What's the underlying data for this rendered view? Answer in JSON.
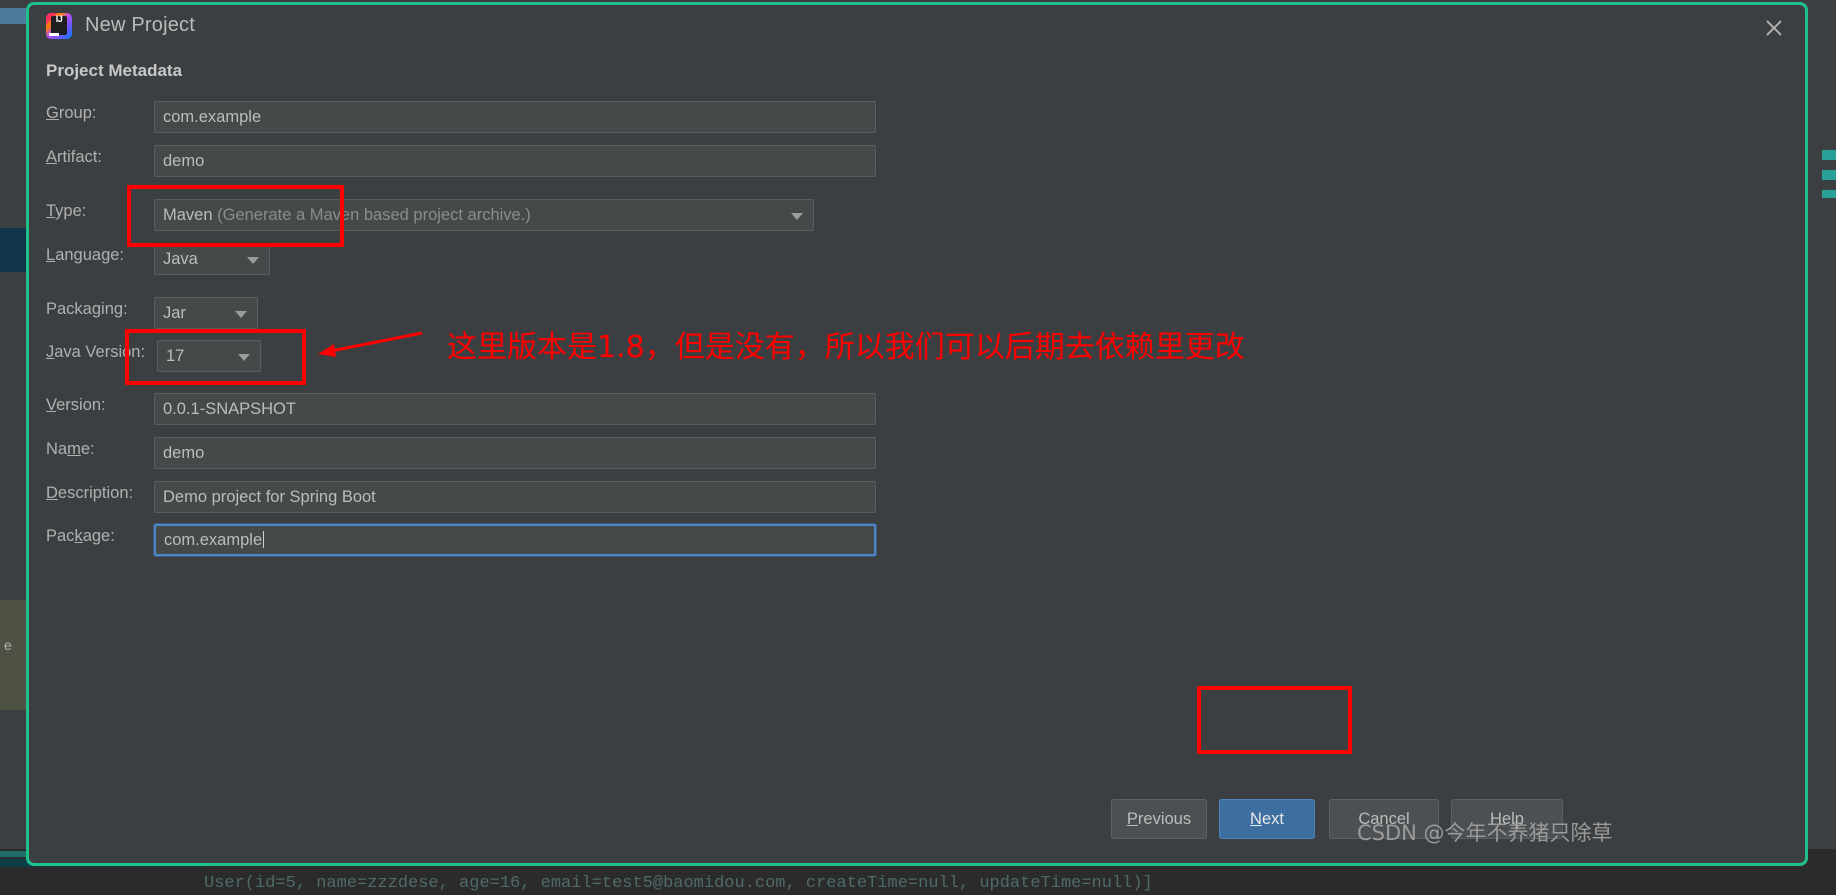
{
  "dialog": {
    "title": "New Project",
    "logo_text": "IJ",
    "close_icon": "close-icon",
    "section_title": "Project Metadata",
    "accent_border": "#21c08b"
  },
  "form": {
    "group": {
      "label_pre": "",
      "label_mnemonic": "G",
      "label_post": "roup:",
      "value": "com.example"
    },
    "artifact": {
      "label_pre": "",
      "label_mnemonic": "A",
      "label_post": "rtifact:",
      "value": "demo"
    },
    "type": {
      "label_pre": "",
      "label_mnemonic": "T",
      "label_post": "ype:",
      "value": "Maven",
      "hint": "(Generate a Maven based project archive.)"
    },
    "language": {
      "label_pre": "",
      "label_mnemonic": "L",
      "label_post": "anguage:",
      "value": "Java"
    },
    "packaging": {
      "label_pre": "Packa",
      "label_mnemonic": "g",
      "label_post": "ing:",
      "value": "Jar"
    },
    "java_version": {
      "label_pre": "",
      "label_mnemonic": "J",
      "label_post": "ava Version:",
      "value": "17"
    },
    "version": {
      "label_pre": "",
      "label_mnemonic": "V",
      "label_post": "ersion:",
      "value": "0.0.1-SNAPSHOT"
    },
    "name": {
      "label_pre": "Na",
      "label_mnemonic": "m",
      "label_post": "e:",
      "value": "demo"
    },
    "description": {
      "label_pre": "",
      "label_mnemonic": "D",
      "label_post": "escription:",
      "value": "Demo project for Spring Boot"
    },
    "package": {
      "label_pre": "Pac",
      "label_mnemonic": "k",
      "label_post": "age:",
      "value": "com.example",
      "focused": true
    }
  },
  "annotations": {
    "note_text": "这里版本是1.8，但是没有，所以我们可以后期去依赖里更改",
    "highlight_color": "#ff0000"
  },
  "buttons": {
    "previous": {
      "pre": "",
      "mnemonic": "P",
      "post": "revious"
    },
    "next": {
      "pre": "",
      "mnemonic": "N",
      "post": "ext"
    },
    "cancel": {
      "pre": "Cancel",
      "mnemonic": "",
      "post": ""
    },
    "help": {
      "pre": "Help",
      "mnemonic": "",
      "post": ""
    }
  },
  "watermark": {
    "text": "CSDN @今年不养猪只除草"
  },
  "background": {
    "console_text": "User(id=5, name=zzzdese, age=16, email=test5@baomidou.com, createTime=null, updateTime=null)]"
  }
}
